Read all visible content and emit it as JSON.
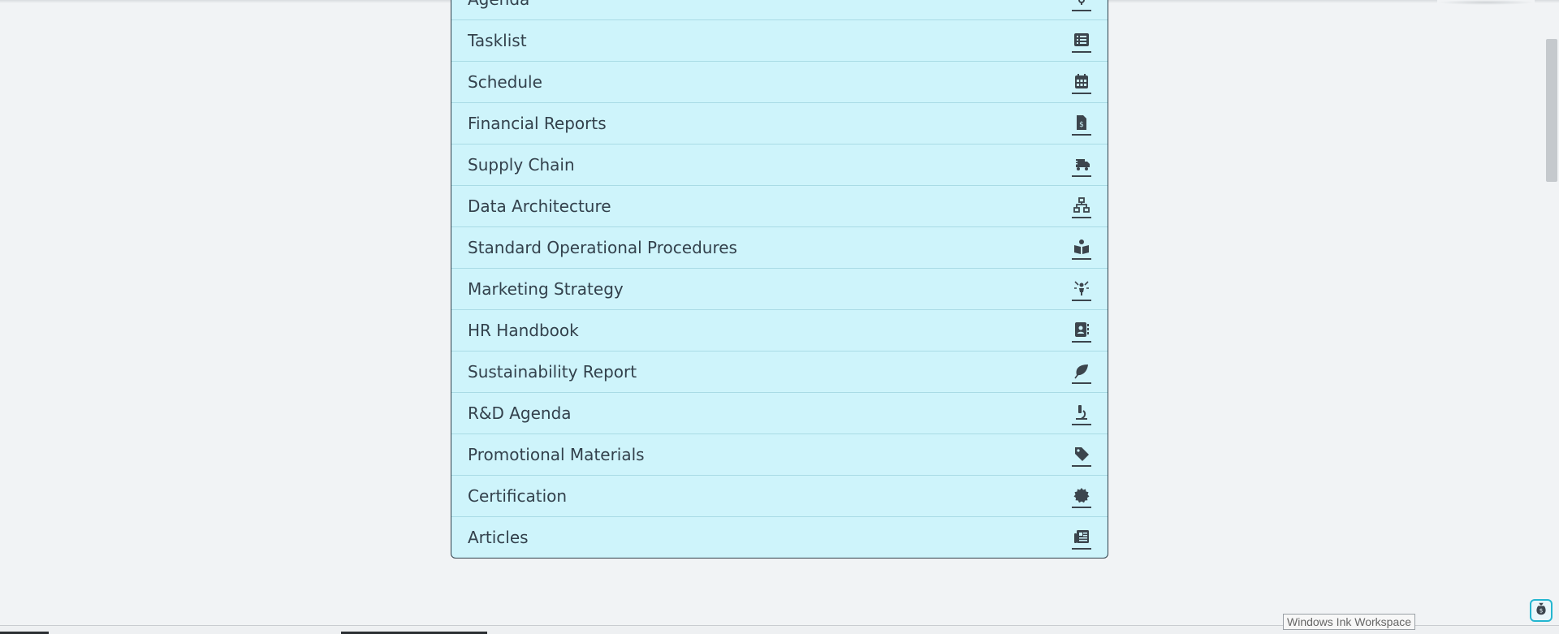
{
  "list": {
    "items": [
      {
        "label": "Agenda",
        "icon": "bulb-icon"
      },
      {
        "label": "Tasklist",
        "icon": "list-icon"
      },
      {
        "label": "Schedule",
        "icon": "calendar-icon"
      },
      {
        "label": "Financial Reports",
        "icon": "invoice-dollar-icon"
      },
      {
        "label": "Supply Chain",
        "icon": "truck-fast-icon"
      },
      {
        "label": "Data Architecture",
        "icon": "sitemap-icon"
      },
      {
        "label": "Standard Operational Procedures",
        "icon": "book-reader-icon"
      },
      {
        "label": "Marketing Strategy",
        "icon": "person-rays-icon"
      },
      {
        "label": "HR Handbook",
        "icon": "address-book-icon"
      },
      {
        "label": "Sustainability Report",
        "icon": "leaf-icon"
      },
      {
        "label": "R&D Agenda",
        "icon": "microscope-icon"
      },
      {
        "label": "Promotional Materials",
        "icon": "tag-icon"
      },
      {
        "label": "Certification",
        "icon": "certificate-icon"
      },
      {
        "label": "Articles",
        "icon": "newspaper-icon"
      }
    ]
  },
  "taskbar": {
    "ink_tooltip": "Windows Ink Workspace"
  },
  "colors": {
    "row_bg": "#cef4fb",
    "row_border": "#a9dbe5",
    "icon": "#3c454d",
    "page_bg": "#f1f3f5"
  }
}
